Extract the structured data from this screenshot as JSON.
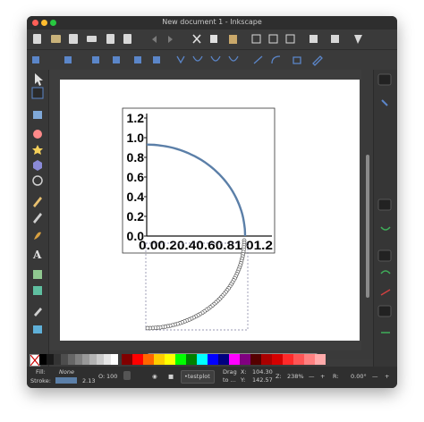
{
  "window": {
    "title": "New document 1 - Inkscape",
    "traffic_lights": [
      "#ff5f57",
      "#febc2e",
      "#28c840"
    ]
  },
  "colors": {
    "window_bg": "#3b3b3b",
    "curve": "#5b7fa8",
    "selection_dash": "#7a7a9a"
  },
  "toolbar_top": {
    "icons": [
      "new-document-icon",
      "open-icon",
      "save-icon",
      "print-icon",
      "import-icon",
      "export-icon",
      "undo-icon",
      "redo-icon",
      "cut-icon",
      "copy-icon",
      "paste-icon",
      "zoom-selection-icon",
      "zoom-drawing-icon",
      "zoom-page-icon",
      "duplicate-icon",
      "clone-icon",
      "unlink-clone-icon",
      "group-icon",
      "ungroup-icon",
      "fill-stroke-icon",
      "xml-editor-icon"
    ]
  },
  "toolbar_nodes": {
    "icons": [
      "insert-node-icon",
      "delete-node-icon",
      "join-nodes-icon",
      "break-path-icon",
      "join-segment-icon",
      "delete-segment-icon",
      "cusp-node-icon",
      "smooth-node-icon",
      "symmetric-node-icon",
      "auto-smooth-icon",
      "line-segment-icon",
      "curve-segment-icon",
      "object-to-path-icon",
      "stroke-to-path-icon"
    ]
  },
  "tools": [
    "selector-icon",
    "node-icon",
    "rectangle-icon",
    "circle-icon",
    "star-icon",
    "3d-box-icon",
    "spiral-icon",
    "pencil-icon",
    "pen-icon",
    "calligraphy-icon",
    "text-icon",
    "spray-icon",
    "eraser-icon",
    "paint-bucket-icon",
    "gradient-icon",
    "mesh-icon",
    "dropper-icon",
    "connector-icon"
  ],
  "plot": {
    "y_ticks": [
      "1.2",
      "1.0",
      "0.8",
      "0.6",
      "0.4",
      "0.2",
      "0.0"
    ],
    "x_tick_text": "0.00.20.40.60.81.01.2"
  },
  "palette": {
    "no_paint_label": "X",
    "grays": [
      "#000000",
      "#1a1a1a",
      "#333333",
      "#4d4d4d",
      "#666666",
      "#808080",
      "#999999",
      "#b3b3b3",
      "#cccccc",
      "#e6e6e6",
      "#ffffff"
    ],
    "colors": [
      "#800000",
      "#ff0000",
      "#ff6600",
      "#ffcc00",
      "#ffff00",
      "#00ff00",
      "#008000",
      "#00ffff",
      "#0000ff",
      "#000080",
      "#ff00ff",
      "#800080",
      "#550000",
      "#aa0000",
      "#d40000",
      "#ff2a2a",
      "#ff5555",
      "#ff8080",
      "#ffaaaa"
    ]
  },
  "status": {
    "fill_label": "Fill:",
    "fill_value": "None",
    "stroke_label": "Stroke:",
    "stroke_width": "2.13",
    "opacity_label": "O:",
    "opacity_value": "100",
    "layer_name": "•testplot",
    "hint_line1": "Drag",
    "hint_line2": "to ...",
    "x_label": "X:",
    "x_value": "104.30",
    "y_label": "Y:",
    "y_value": "142.57",
    "zoom_label": "Z:",
    "zoom_value": "238%",
    "rotate_label": "R:",
    "rotate_value": "0.00°",
    "minus": "—",
    "plus": "+"
  }
}
